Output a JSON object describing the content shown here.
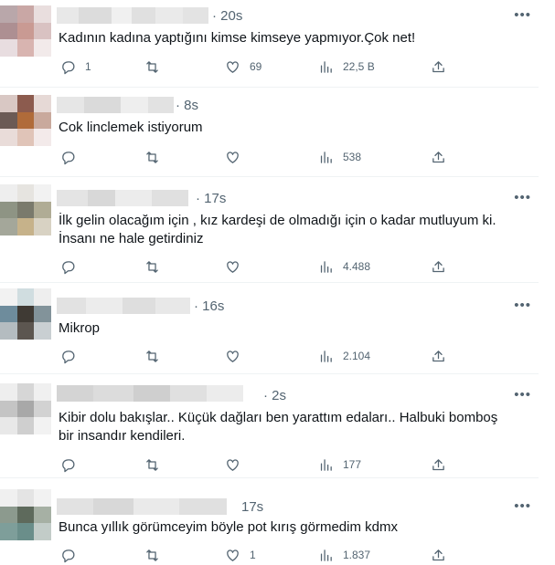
{
  "icons": {
    "reply": "reply-icon",
    "retweet": "retweet-icon",
    "like": "heart-icon",
    "views": "views-icon",
    "share": "share-icon",
    "more": "more-icon"
  },
  "colors": {
    "text": "#0f1419",
    "muted": "#536471",
    "divider": "#eff3f4"
  },
  "tweets": [
    {
      "time": "· 20s",
      "text": "Kadının kadına yaptığını kimse kimseye yapmıyor.Çok net!",
      "replies": "1",
      "retweets": "",
      "likes": "69",
      "views": "22,5 B"
    },
    {
      "time": "· 8s",
      "text": "Cok linclemek istiyorum",
      "replies": "",
      "retweets": "",
      "likes": "",
      "views": "538"
    },
    {
      "time": "· 17s",
      "text": "İlk gelin olacağım için , kız kardeşi de olmadığı için o kadar mutluyum ki.\nİnsanı ne hale getirdiniz",
      "replies": "",
      "retweets": "",
      "likes": "",
      "views": "4.488"
    },
    {
      "time": "· 16s",
      "text": "Mikrop",
      "replies": "",
      "retweets": "",
      "likes": "",
      "views": "2.104"
    },
    {
      "time": "· 2s",
      "text": "Kibir dolu bakışlar.. Küçük dağları ben yarattım edaları.. Halbuki bomboş\nbir insandır kendileri.",
      "replies": "",
      "retweets": "",
      "likes": "",
      "views": "177"
    },
    {
      "time": "17s",
      "text": "Bunca yıllık görümceyim böyle pot kırış görmedim kdmx",
      "replies": "",
      "retweets": "",
      "likes": "1",
      "views": "1.837"
    }
  ]
}
